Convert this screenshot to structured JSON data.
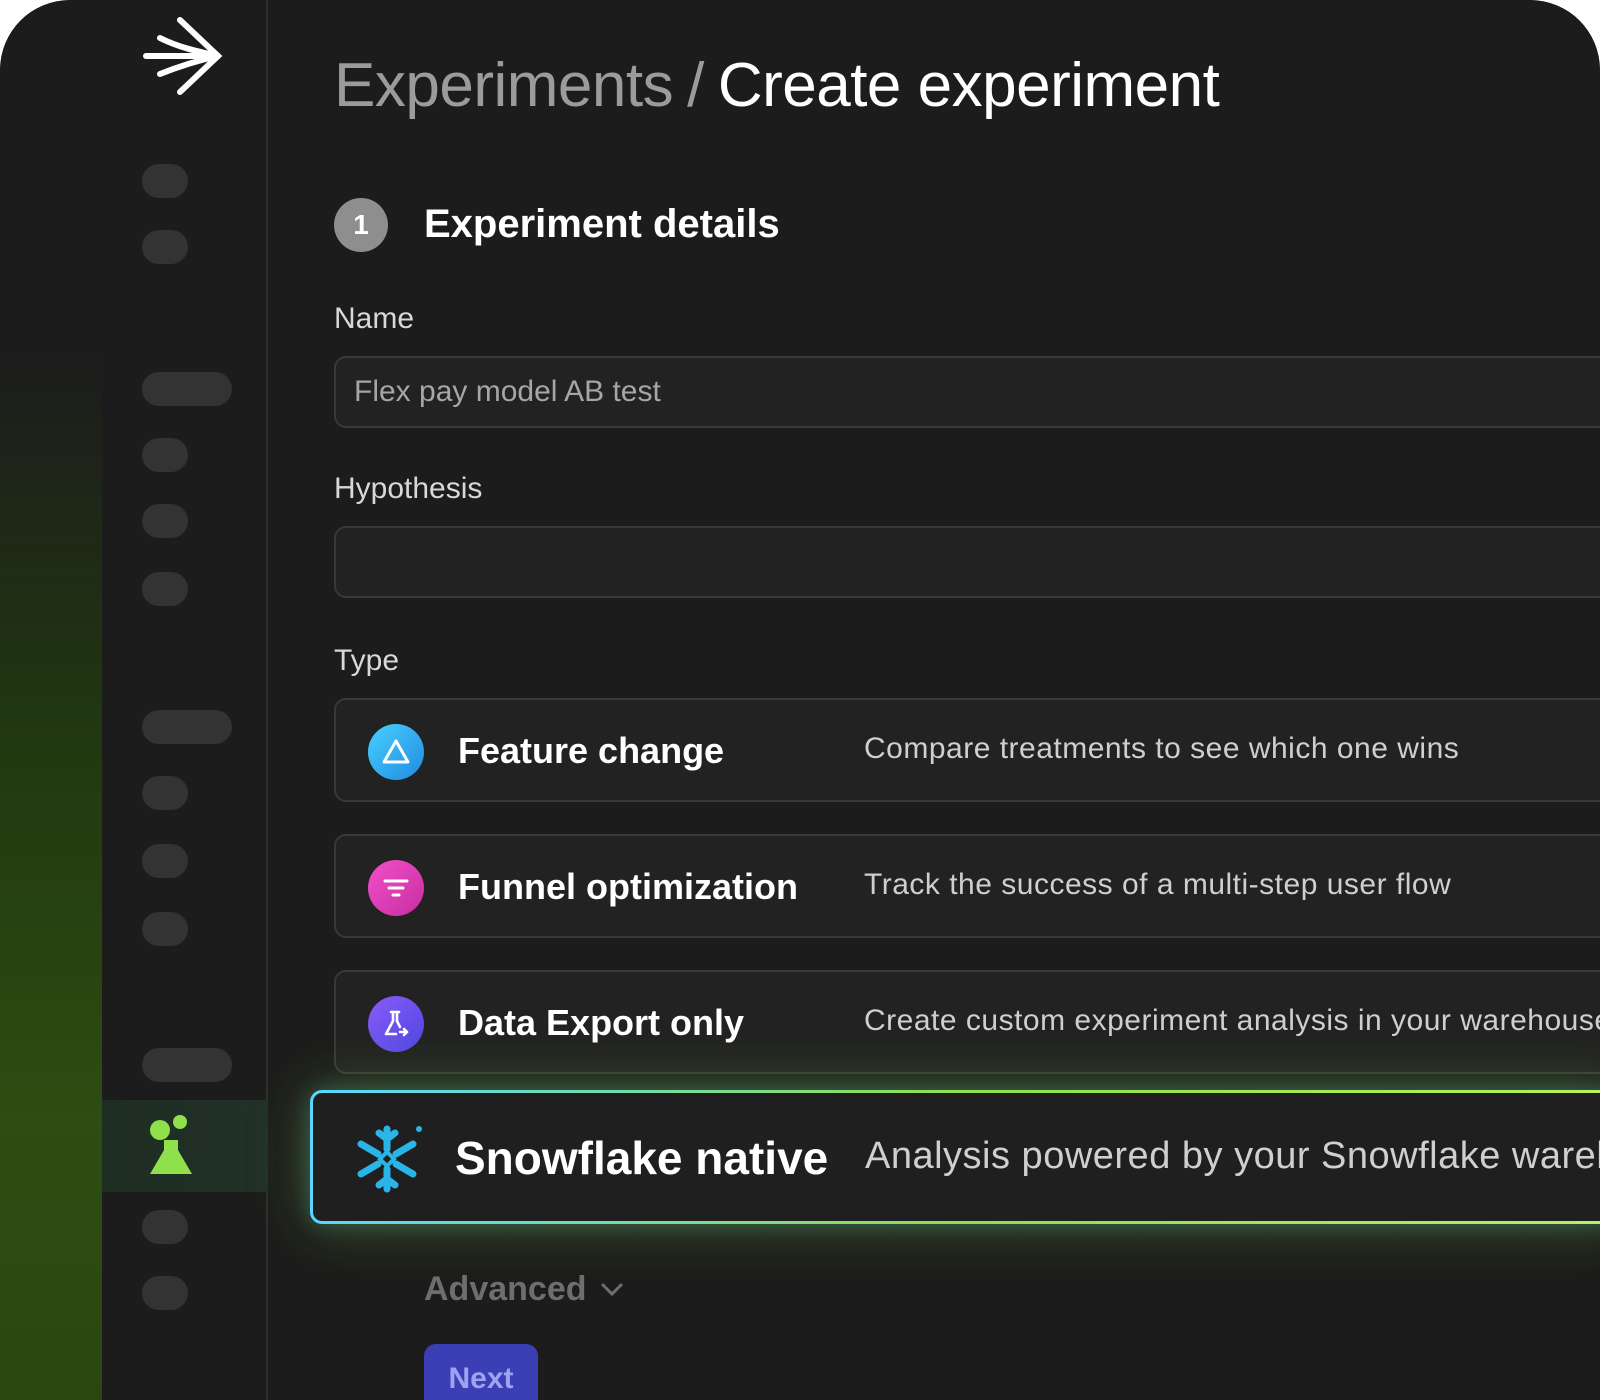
{
  "header": {
    "breadcrumb_parent": "Experiments",
    "separator": "/",
    "current_page": "Create experiment"
  },
  "step": {
    "number": "1",
    "title": "Experiment details"
  },
  "form": {
    "name_label": "Name",
    "name_value": "Flex pay model AB test",
    "hypothesis_label": "Hypothesis",
    "hypothesis_value": "",
    "type_label": "Type"
  },
  "types": [
    {
      "name": "Feature change",
      "description": "Compare treatments to see which one wins",
      "icon": "triangle-icon",
      "color": "#2aa8f0"
    },
    {
      "name": "Funnel optimization",
      "description": "Track the success of a multi-step user flow",
      "icon": "funnel-icon",
      "color": "#e03cb0"
    },
    {
      "name": "Data Export only",
      "description": "Create custom experiment analysis in your warehouse",
      "icon": "flask-export-icon",
      "color": "#6a4cf0"
    },
    {
      "name": "Snowflake native",
      "description": "Analysis powered by your Snowflake warehouse",
      "icon": "snowflake-icon",
      "color": "#29b5e8",
      "selected": true
    }
  ],
  "advanced_label": "Advanced",
  "next_label": "Next",
  "colors": {
    "background": "#1c1c1c",
    "accent_green": "#8fe04a",
    "accent_blue": "#5ad6ff",
    "button": "#3b3fb5"
  }
}
